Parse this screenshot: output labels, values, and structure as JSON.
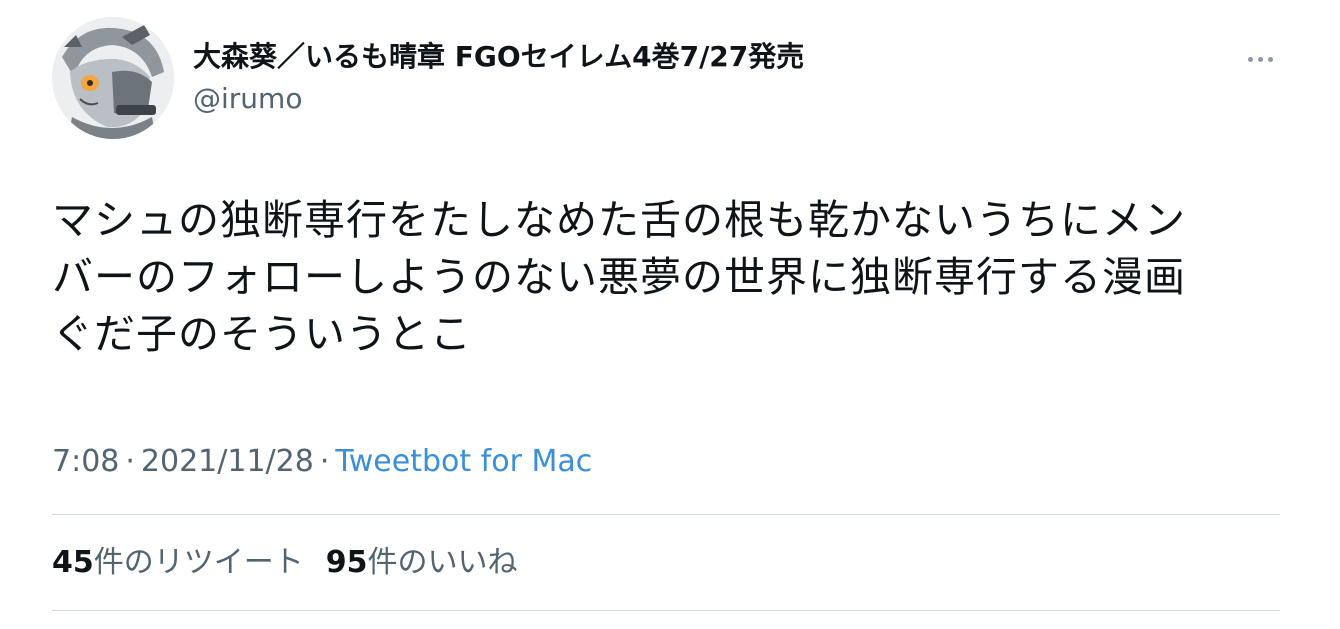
{
  "author": {
    "display_name": "大森葵／いるも晴章 FGOセイレム4巻7/27発売",
    "handle": "@irumo"
  },
  "tweet": {
    "text": "マシュの独断専行をたしなめた舌の根も乾かないうちにメン\nバーのフォローしようのない悪夢の世界に独断専行する漫画\nぐだ子のそういうとこ"
  },
  "meta": {
    "time": "7:08",
    "separator": "·",
    "date": "2021/11/28",
    "source": "Tweetbot for Mac"
  },
  "stats": {
    "retweets_count": "45",
    "retweets_label": "件のリツイート",
    "likes_count": "95",
    "likes_label": "件のいいね"
  },
  "icons": {
    "more": "more-horizontal-icon",
    "avatar": "avatar-image"
  },
  "colors": {
    "text": "#0f1419",
    "secondary": "#536471",
    "link": "#3b8fd9",
    "divider": "#cfd9de"
  }
}
